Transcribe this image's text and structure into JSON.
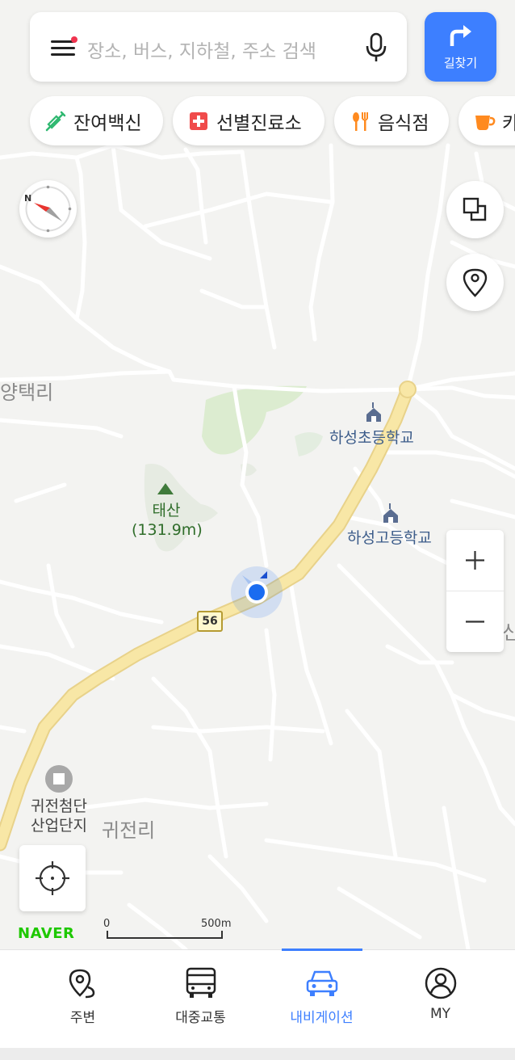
{
  "search": {
    "placeholder": "장소, 버스, 지하철, 주소 검색",
    "menu_icon": "menu-icon",
    "mic_icon": "microphone-icon",
    "notification_color": "#f0344f"
  },
  "route_button": {
    "label": "길찾기",
    "icon": "turn-right-arrow-icon",
    "color": "#3d7fff"
  },
  "chips": [
    {
      "label": "잔여백신",
      "icon": "syringe-icon",
      "color": "#2fb870"
    },
    {
      "label": "선별진료소",
      "icon": "medical-cross-icon",
      "color": "#f04b4b"
    },
    {
      "label": "음식점",
      "icon": "fork-knife-icon",
      "color": "#ff8a1f"
    },
    {
      "label": "카",
      "icon": "coffee-cup-icon",
      "color": "#ff8a1f"
    }
  ],
  "map_controls": {
    "compass": "compass-icon",
    "layers": "layers-icon",
    "saved_places": "location-pin-icon",
    "zoom_in": "+",
    "zoom_out": "−",
    "current_location": "crosshair-icon"
  },
  "map_labels": {
    "villages": [
      "양택리",
      "귀전리",
      "신"
    ],
    "schools": [
      "하성초등학교",
      "하성고등학교"
    ],
    "mountain": {
      "name": "태산",
      "elevation": "(131.9m)"
    },
    "industrial": [
      "귀전첨단",
      "산업단지"
    ],
    "road_number": "56"
  },
  "brand": "NAVER",
  "scale": {
    "start": "0",
    "end": "500m"
  },
  "tabs": [
    {
      "label": "주변",
      "icon": "nearby-pin-icon",
      "active": false
    },
    {
      "label": "대중교통",
      "icon": "bus-icon",
      "active": false
    },
    {
      "label": "내비게이션",
      "icon": "car-icon",
      "active": true
    },
    {
      "label": "MY",
      "icon": "profile-icon",
      "active": false
    }
  ],
  "colors": {
    "accent": "#3d7fff",
    "main_road": "#f7e3a0",
    "green_area": "#dcecd0",
    "school_icon": "#5a6d91",
    "location_dot": "#1a6cf0"
  }
}
